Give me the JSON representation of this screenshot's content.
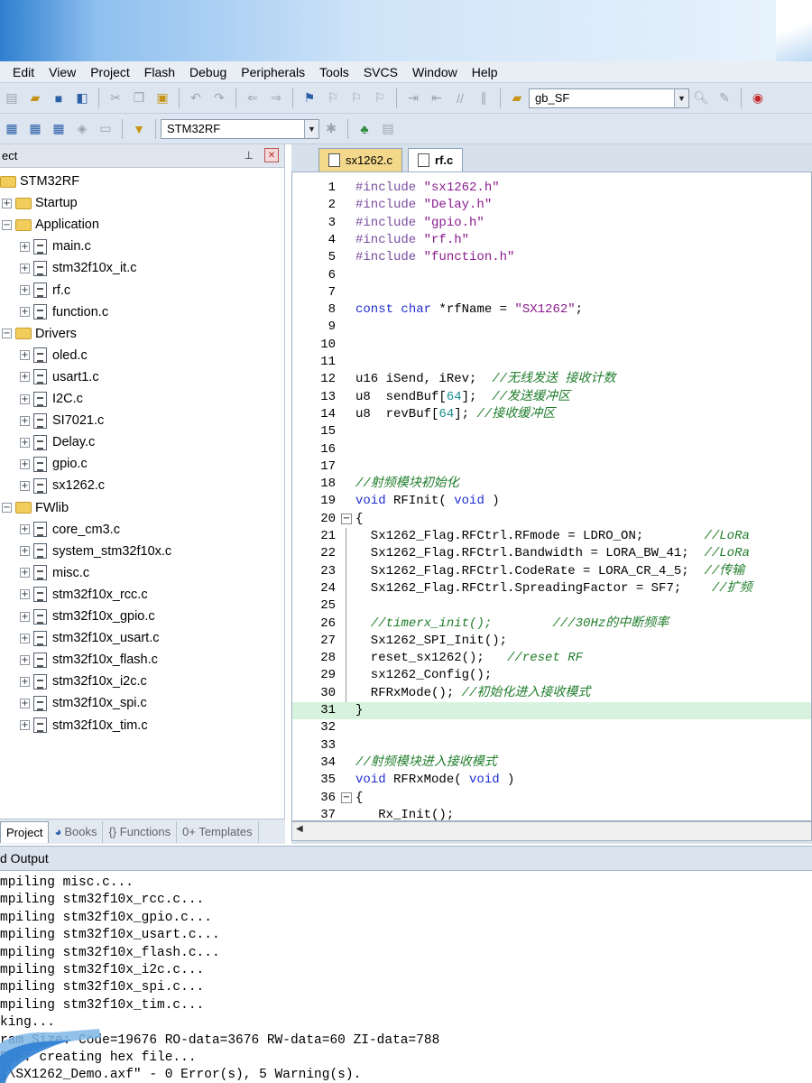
{
  "menu": [
    "Edit",
    "View",
    "Project",
    "Flash",
    "Debug",
    "Peripherals",
    "Tools",
    "SVCS",
    "Window",
    "Help"
  ],
  "toolbar": {
    "search_combo_value": "gb_SF",
    "target_combo_value": "STM32RF"
  },
  "project_panel": {
    "title": "ect",
    "root": "STM32RF",
    "groups": [
      {
        "name": "Startup",
        "files": []
      },
      {
        "name": "Application",
        "files": [
          "main.c",
          "stm32f10x_it.c",
          "rf.c",
          "function.c"
        ]
      },
      {
        "name": "Drivers",
        "files": [
          "oled.c",
          "usart1.c",
          "I2C.c",
          "SI7021.c",
          "Delay.c",
          "gpio.c",
          "sx1262.c"
        ]
      },
      {
        "name": "FWlib",
        "files": [
          "core_cm3.c",
          "system_stm32f10x.c",
          "misc.c",
          "stm32f10x_rcc.c",
          "stm32f10x_gpio.c",
          "stm32f10x_usart.c",
          "stm32f10x_flash.c",
          "stm32f10x_i2c.c",
          "stm32f10x_spi.c",
          "stm32f10x_tim.c"
        ]
      }
    ],
    "tabs": [
      "Project",
      "Books",
      "{} Functions",
      "0+ Templates"
    ]
  },
  "editor": {
    "tabs": [
      "sx1262.c",
      "rf.c"
    ],
    "active_tab": "rf.c",
    "lines": [
      "#include \"sx1262.h\"",
      "#include \"Delay.h\"",
      "#include \"gpio.h\"",
      "#include \"rf.h\"",
      "#include \"function.h\"",
      "",
      "",
      "const char *rfName = \"SX1262\";",
      "",
      "",
      "",
      "u16 iSend, iRev;  //无线发送 接收计数",
      "u8  sendBuf[64];  //发送缓冲区",
      "u8  revBuf[64]; //接收缓冲区",
      "",
      "",
      "",
      "//射频模块初始化",
      "void RFInit( void )",
      "{",
      "  Sx1262_Flag.RFCtrl.RFmode = LDRO_ON;        //LoRa",
      "  Sx1262_Flag.RFCtrl.Bandwidth = LORA_BW_41;  //LoRa",
      "  Sx1262_Flag.RFCtrl.CodeRate = LORA_CR_4_5;  //传输",
      "  Sx1262_Flag.RFCtrl.SpreadingFactor = SF7;    //扩频",
      "",
      "  //timerx_init();        ///30Hz的中断频率",
      "  Sx1262_SPI_Init();",
      "  reset_sx1262();   //reset RF",
      "  sx1262_Config();",
      "  RFRxMode(); //初始化进入接收模式",
      "}",
      "",
      "",
      "//射频模块进入接收模式",
      "void RFRxMode( void )",
      "{",
      "   Rx_Init();"
    ]
  },
  "output": {
    "title": "d Output",
    "lines": [
      "mpiling misc.c...",
      "mpiling stm32f10x_rcc.c...",
      "mpiling stm32f10x_gpio.c...",
      "mpiling stm32f10x_usart.c...",
      "mpiling stm32f10x_flash.c...",
      "mpiling stm32f10x_i2c.c...",
      "mpiling stm32f10x_spi.c...",
      "mpiling stm32f10x_tim.c...",
      "king...",
      "ram Size: Code=19676 RO-data=3676 RW-data=60 ZI-data=788",
      "ELF: creating hex file...",
      "j\\SX1262_Demo.axf\" - 0 Error(s), 5 Warning(s)."
    ]
  },
  "colors": {
    "keyword": "#1f2fd0",
    "preprocessor": "#7a4da0",
    "string": "#8b1b8f",
    "comment": "#1f7d2b",
    "number": "#1c8d8d",
    "current_line": "#d8f3dd"
  }
}
